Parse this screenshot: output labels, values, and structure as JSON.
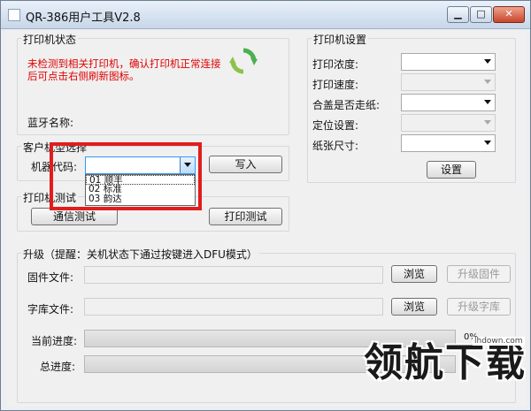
{
  "window": {
    "title": "QR-386用户工具V2.8",
    "min_glyph": "▁",
    "max_glyph": "□",
    "close_glyph": "✕"
  },
  "printer_status": {
    "group_label": "打印机状态",
    "error_text": "未检测到相关打印机，确认打印机正常连接后可点击右侧刷新图标。",
    "bt_name_label": "蓝牙名称:"
  },
  "printer_settings": {
    "group_label": "打印机设置",
    "density_label": "打印浓度:",
    "speed_label": "打印速度:",
    "cover_label": "合盖是否走纸:",
    "position_label": "定位设置:",
    "paper_label": "纸张尺寸:",
    "set_button": "设置"
  },
  "customer_model": {
    "group_label": "客户机型选择",
    "code_label": "机器代码:",
    "code_value": "",
    "write_button": "写入",
    "options": [
      "01 顺丰",
      "02 标准",
      "03 韵达"
    ]
  },
  "print_test": {
    "group_label": "打印机测试",
    "comm_test_button": "通信测试",
    "print_test_button": "打印测试"
  },
  "upgrade": {
    "group_label": "升级（提醒：关机状态下通过按键进入DFU模式）",
    "firmware_label": "固件文件:",
    "font_label": "字库文件:",
    "browse_button": "浏览",
    "upgrade_firmware_button": "升级固件",
    "upgrade_font_button": "升级字库",
    "current_progress_label": "当前进度:",
    "total_progress_label": "总进度:",
    "current_progress_value": "0%",
    "total_progress_value": "0%",
    "current_progress": 0,
    "total_progress": 0
  },
  "watermark": {
    "text": "领航下载",
    "url": "lhdown.com"
  },
  "colors": {
    "error": "#e00000",
    "accent": "#3399ff",
    "highlight_box": "#e11d1d",
    "refresh": "#4caf50"
  }
}
